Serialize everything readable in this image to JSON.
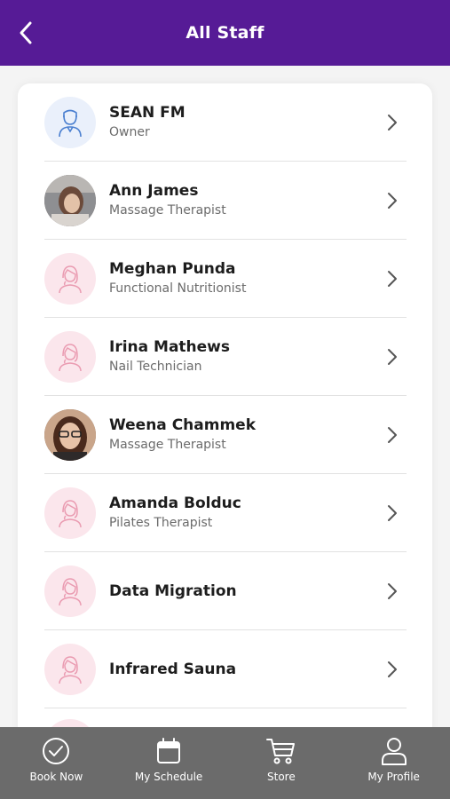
{
  "header": {
    "title": "All Staff"
  },
  "staff": [
    {
      "name": "SEAN FM",
      "role": "Owner",
      "avatar": "owner-icon"
    },
    {
      "name": "Ann James",
      "role": "Massage Therapist",
      "avatar": "photo"
    },
    {
      "name": "Meghan Punda",
      "role": "Functional Nutritionist",
      "avatar": "female-icon"
    },
    {
      "name": "Irina Mathews",
      "role": "Nail Technician",
      "avatar": "female-icon"
    },
    {
      "name": "Weena Chammek",
      "role": "Massage Therapist",
      "avatar": "photo"
    },
    {
      "name": "Amanda Bolduc",
      "role": "Pilates Therapist",
      "avatar": "female-icon"
    },
    {
      "name": "Data Migration",
      "role": "",
      "avatar": "female-icon"
    },
    {
      "name": "Infrared Sauna",
      "role": "",
      "avatar": "female-icon"
    }
  ],
  "tabbar": {
    "items": [
      {
        "label": "Book Now",
        "icon": "check-circle-icon"
      },
      {
        "label": "My Schedule",
        "icon": "calendar-icon"
      },
      {
        "label": "Store",
        "icon": "cart-icon"
      },
      {
        "label": "My Profile",
        "icon": "person-icon"
      }
    ]
  },
  "colors": {
    "header": "#561b96",
    "tabbar": "#6b6b6b",
    "female_avatar_bg": "#fbe6ec",
    "owner_avatar_bg": "#eaf0fb"
  }
}
